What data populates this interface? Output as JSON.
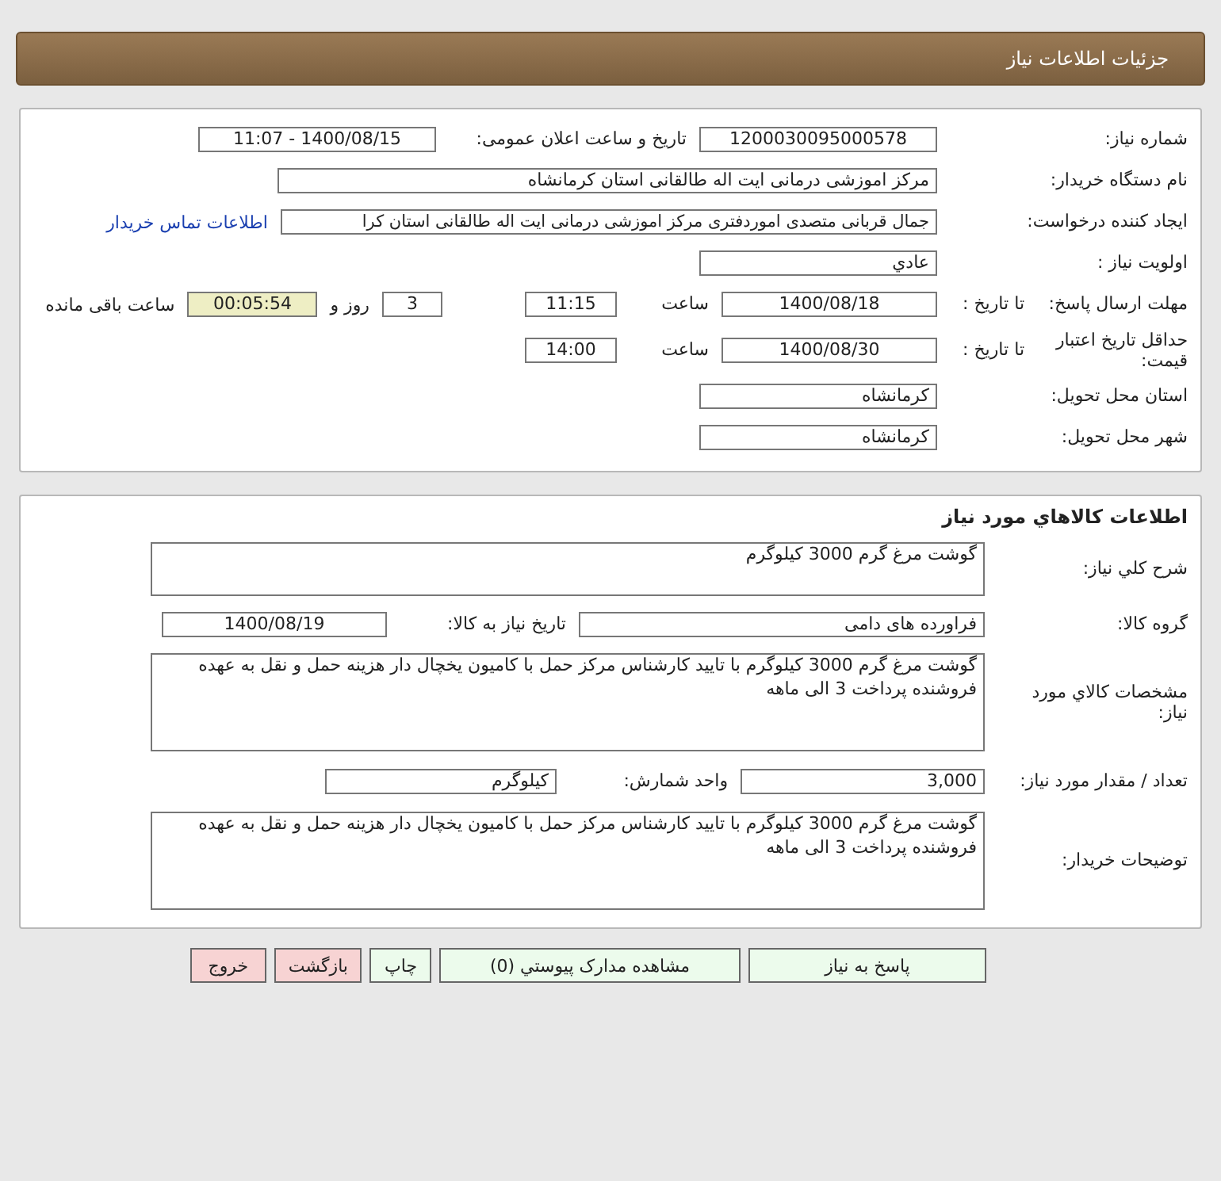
{
  "header": {
    "title": "جزئيات اطلاعات نياز"
  },
  "need_info": {
    "need_number": {
      "label": "شماره نياز:",
      "value": "1200030095000578"
    },
    "announce": {
      "label": "تاريخ و ساعت اعلان عمومی:",
      "value": "1400/08/15 - 11:07"
    },
    "buyer": {
      "label": "نام دستگاه خريدار:",
      "value": "مرکز اموزشی درمانی ایت اله طالقانی استان کرمانشاه"
    },
    "requester": {
      "label": "ايجاد کننده درخواست:",
      "value": "جمال قربانی متصدی اموردفتری مرکز اموزشی درمانی ایت اله طالقانی استان کرا",
      "link": "اطلاعات تماس خريدار"
    },
    "priority": {
      "label": "اولويت نياز :",
      "value": "عادي"
    },
    "reply_deadline": {
      "label": "مهلت ارسال پاسخ:",
      "sub_label": "تا تاريخ :",
      "date": "1400/08/18",
      "time_label": "ساعت",
      "time": "11:15",
      "days": "3",
      "days_label": "روز و",
      "remaining": "00:05:54",
      "remaining_label": "ساعت باقی مانده"
    },
    "price_validity": {
      "label": "حداقل تاريخ اعتبار قيمت:",
      "sub_label": "تا تاريخ :",
      "date": "1400/08/30",
      "time_label": "ساعت",
      "time": "14:00"
    },
    "province": {
      "label": "استان محل تحويل:",
      "value": "کرمانشاه"
    },
    "city": {
      "label": "شهر محل تحويل:",
      "value": "کرمانشاه"
    }
  },
  "goods": {
    "title": "اطلاعات کالاهاي مورد نياز",
    "general_desc": {
      "label": "شرح کلي نياز:",
      "value": "گوشت مرغ گرم 3000 کیلوگرم"
    },
    "group": {
      "label": "گروه کالا:",
      "value": "فراورده های دامی"
    },
    "need_date": {
      "label": "تاريخ نياز به کالا:",
      "value": "1400/08/19"
    },
    "specs": {
      "label": "مشخصات کالاي مورد نياز:",
      "value": "گوشت مرغ گرم 3000 کیلوگرم با تایید کارشناس مرکز حمل با کامیون یخچال دار هزینه حمل و نقل به عهده فروشنده پرداخت 3 الی ماهه"
    },
    "quantity": {
      "label": "تعداد / مقدار مورد نياز:",
      "value": "3,000"
    },
    "unit": {
      "label": "واحد شمارش:",
      "value": "کیلوگرم"
    },
    "buyer_notes": {
      "label": "توضيحات خريدار:",
      "value": "گوشت مرغ گرم 3000 کیلوگرم با تایید کارشناس مرکز حمل با کامیون یخچال دار هزینه حمل و نقل به عهده فروشنده پرداخت 3 الی ماهه"
    }
  },
  "buttons": [
    {
      "label": "پاسخ به نياز",
      "kind": "normal"
    },
    {
      "label": "مشاهده مدارک پيوستي (0)",
      "kind": "normal"
    },
    {
      "label": "چاپ",
      "kind": "normal"
    },
    {
      "label": "بازگشت",
      "kind": "danger"
    },
    {
      "label": "خروج",
      "kind": "danger"
    }
  ]
}
